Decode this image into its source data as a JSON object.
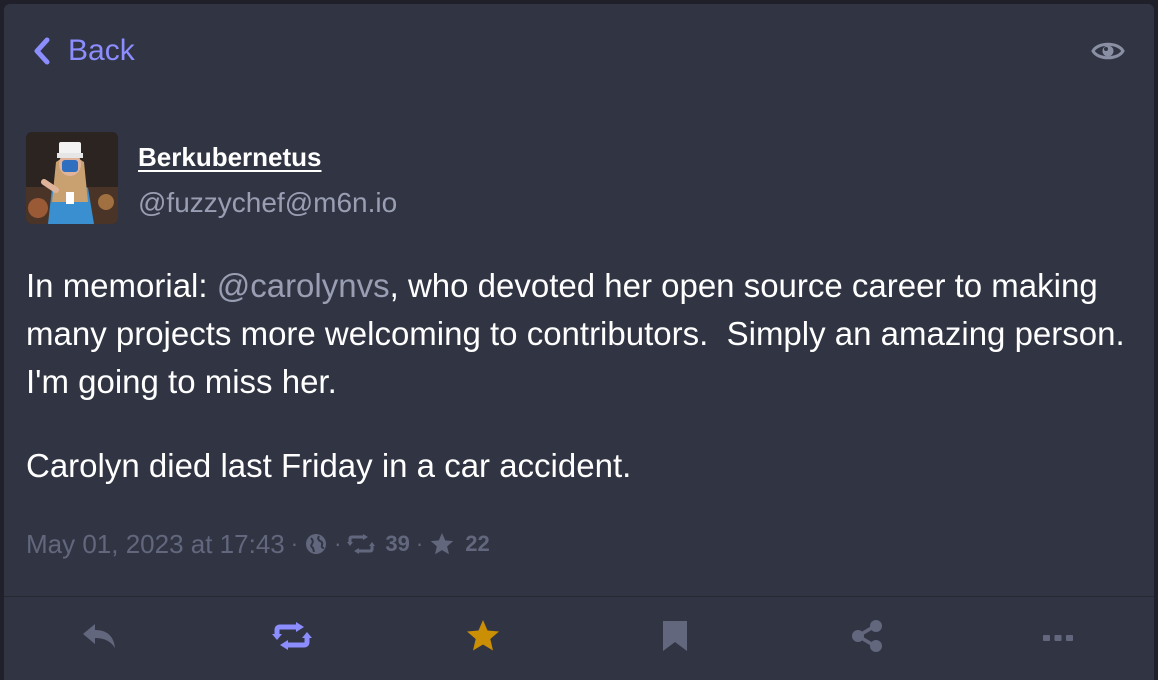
{
  "header": {
    "back_label": "Back",
    "back_icon": "chevron-left-icon",
    "visibility_icon": "eye-icon"
  },
  "account": {
    "display_name": "Berkubernetus",
    "handle": "@fuzzychef@m6n.io",
    "avatar": "avatar"
  },
  "status": {
    "paragraph1_prefix": "In memorial: ",
    "mention": "@carolynvs",
    "paragraph1_suffix": ", who devoted her open source career to making many projects more welcoming to contributors.  Simply an amazing person.  I'm going to miss her.",
    "paragraph2": "Carolyn died last Friday in a car accident."
  },
  "meta": {
    "timestamp": "May 01, 2023 at 17:43",
    "separator": "·",
    "visibility_icon": "globe-icon",
    "boost_count": "39",
    "favourite_count": "22"
  },
  "actions": [
    {
      "name": "reply",
      "icon": "reply-icon"
    },
    {
      "name": "boost",
      "icon": "boost-icon"
    },
    {
      "name": "favourite",
      "icon": "star-icon"
    },
    {
      "name": "bookmark",
      "icon": "bookmark-icon"
    },
    {
      "name": "share",
      "icon": "share-icon"
    },
    {
      "name": "more",
      "icon": "ellipsis-icon"
    }
  ],
  "colors": {
    "background": "#313543",
    "accent": "#8c8dff",
    "favourite": "#ca8f04",
    "muted": "#62677d"
  }
}
